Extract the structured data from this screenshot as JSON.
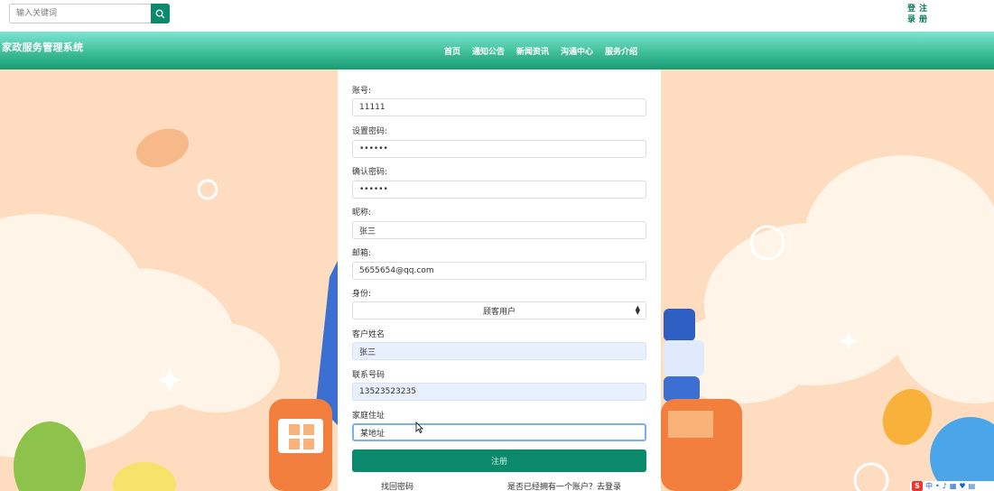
{
  "topbar": {
    "search_placeholder": "输入关键词",
    "auth": {
      "login": [
        "登",
        "录"
      ],
      "register": [
        "注",
        "册"
      ]
    }
  },
  "header": {
    "brand": "家政服务管理系统",
    "nav": [
      "首页",
      "通知公告",
      "新闻资讯",
      "沟通中心",
      "服务介绍"
    ]
  },
  "form": {
    "account": {
      "label": "账号:",
      "value": "11111"
    },
    "password": {
      "label": "设置密码:",
      "value": "••••••"
    },
    "confirm_password": {
      "label": "确认密码:",
      "value": "••••••"
    },
    "nickname": {
      "label": "昵称:",
      "value": "张三"
    },
    "email": {
      "label": "邮箱:",
      "value": "5655654@qq.com"
    },
    "role": {
      "label": "身份:",
      "selected": "顾客用户"
    },
    "customer_name": {
      "label": "客户姓名",
      "value": "张三"
    },
    "phone": {
      "label": "联系号码",
      "value": "13523523235"
    },
    "address": {
      "label": "家庭住址",
      "value": "某地址"
    },
    "submit_label": "注册",
    "forgot_password": "找回密码",
    "have_account": "是否已经拥有一个账户？去登录"
  },
  "ime": {
    "logo": "S",
    "mode": "中"
  },
  "colors": {
    "primary": "#0a8a6a",
    "header_top": "#7de5d2",
    "header_bottom": "#1a9a72",
    "background": "#fddcbf"
  }
}
